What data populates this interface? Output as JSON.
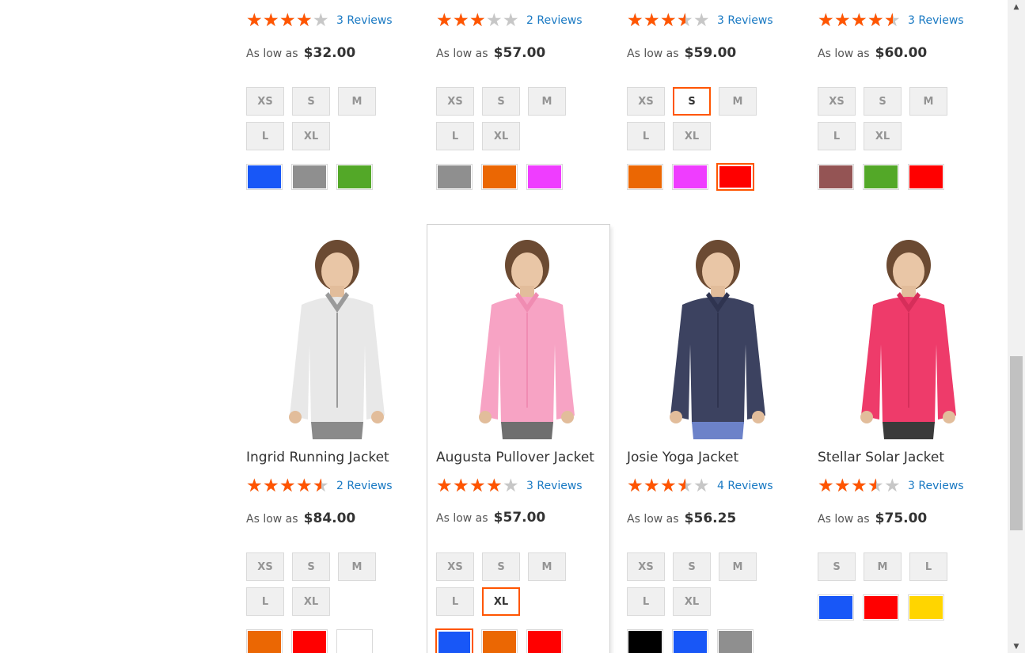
{
  "products": [
    {
      "name": "",
      "rating_percent": 80,
      "reviews": "3 Reviews",
      "price_label": "As low as",
      "price": "$32.00",
      "sizes": [
        {
          "label": "XS"
        },
        {
          "label": "S"
        },
        {
          "label": "M"
        },
        {
          "label": "L"
        },
        {
          "label": "XL"
        }
      ],
      "colors": [
        {
          "name": "blue",
          "hex": "#1857f7"
        },
        {
          "name": "gray",
          "hex": "#8f8f8f"
        },
        {
          "name": "green",
          "hex": "#53a828"
        }
      ]
    },
    {
      "name": "",
      "rating_percent": 60,
      "reviews": "2 Reviews",
      "price_label": "As low as",
      "price": "$57.00",
      "sizes": [
        {
          "label": "XS"
        },
        {
          "label": "S"
        },
        {
          "label": "M"
        },
        {
          "label": "L"
        },
        {
          "label": "XL"
        }
      ],
      "colors": [
        {
          "name": "gray",
          "hex": "#8f8f8f"
        },
        {
          "name": "orange",
          "hex": "#eb6703"
        },
        {
          "name": "purple",
          "hex": "#ef3dff"
        }
      ]
    },
    {
      "name": "",
      "rating_percent": 70,
      "reviews": "3 Reviews",
      "price_label": "As low as",
      "price": "$59.00",
      "sizes": [
        {
          "label": "XS"
        },
        {
          "label": "S",
          "selected": true
        },
        {
          "label": "M"
        },
        {
          "label": "L"
        },
        {
          "label": "XL"
        }
      ],
      "colors": [
        {
          "name": "orange",
          "hex": "#eb6703"
        },
        {
          "name": "purple",
          "hex": "#ef3dff"
        },
        {
          "name": "red",
          "hex": "#ff0000",
          "selected": true
        }
      ]
    },
    {
      "name": "",
      "rating_percent": 90,
      "reviews": "3 Reviews",
      "price_label": "As low as",
      "price": "$60.00",
      "sizes": [
        {
          "label": "XS"
        },
        {
          "label": "S"
        },
        {
          "label": "M"
        },
        {
          "label": "L"
        },
        {
          "label": "XL"
        }
      ],
      "colors": [
        {
          "name": "brown",
          "hex": "#945454"
        },
        {
          "name": "green",
          "hex": "#53a828"
        },
        {
          "name": "red",
          "hex": "#ff0000"
        }
      ]
    },
    {
      "name": "Ingrid Running Jacket",
      "rating_percent": 90,
      "reviews": "2 Reviews",
      "price_label": "As low as",
      "price": "$84.00",
      "image": {
        "jacket": "#e8e8e8",
        "pants": "#8a8a8a",
        "trim": "#9a9a9a"
      },
      "sizes": [
        {
          "label": "XS"
        },
        {
          "label": "S"
        },
        {
          "label": "M"
        },
        {
          "label": "L"
        },
        {
          "label": "XL"
        }
      ],
      "colors": [
        {
          "name": "orange",
          "hex": "#eb6703"
        },
        {
          "name": "red",
          "hex": "#ff0000"
        },
        {
          "name": "white",
          "hex": "#ffffff"
        }
      ]
    },
    {
      "name": "Augusta Pullover Jacket",
      "rating_percent": 80,
      "reviews": "3 Reviews",
      "price_label": "As low as",
      "price": "$57.00",
      "image": {
        "jacket": "#f7a3c4",
        "pants": "#6f6f6f",
        "trim": "#f08cb2"
      },
      "sizes": [
        {
          "label": "XS"
        },
        {
          "label": "S"
        },
        {
          "label": "M"
        },
        {
          "label": "L"
        },
        {
          "label": "XL",
          "selected": true
        }
      ],
      "colors": [
        {
          "name": "blue",
          "hex": "#1857f7",
          "selected": true
        },
        {
          "name": "orange",
          "hex": "#eb6703"
        },
        {
          "name": "red",
          "hex": "#ff0000"
        }
      ]
    },
    {
      "name": "Josie Yoga Jacket",
      "rating_percent": 70,
      "reviews": "4 Reviews",
      "price_label": "As low as",
      "price": "$56.25",
      "image": {
        "jacket": "#3c4260",
        "pants": "#6c82c9",
        "trim": "#2f3450"
      },
      "sizes": [
        {
          "label": "XS"
        },
        {
          "label": "S"
        },
        {
          "label": "M"
        },
        {
          "label": "L"
        },
        {
          "label": "XL"
        }
      ],
      "colors": [
        {
          "name": "black",
          "hex": "#000000"
        },
        {
          "name": "blue",
          "hex": "#1857f7"
        },
        {
          "name": "gray",
          "hex": "#8f8f8f"
        }
      ]
    },
    {
      "name": "Stellar Solar Jacket",
      "rating_percent": 70,
      "reviews": "3 Reviews",
      "price_label": "As low as",
      "price": "$75.00",
      "image": {
        "jacket": "#ee3b6a",
        "pants": "#3a3a3a",
        "trim": "#d62e5a"
      },
      "sizes": [
        {
          "label": "S"
        },
        {
          "label": "M"
        },
        {
          "label": "L"
        }
      ],
      "colors": [
        {
          "name": "blue",
          "hex": "#1857f7"
        },
        {
          "name": "red",
          "hex": "#ff0000"
        },
        {
          "name": "yellow",
          "hex": "#ffd500"
        }
      ]
    }
  ],
  "theme": {
    "accent": "#ff5501",
    "link": "#1979c3"
  }
}
